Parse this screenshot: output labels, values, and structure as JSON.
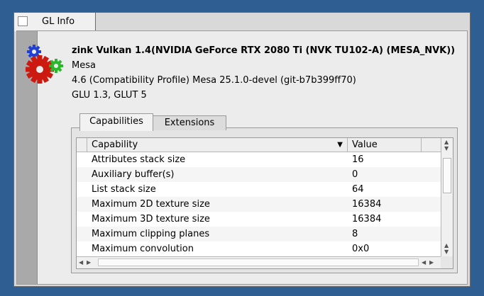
{
  "window": {
    "title": "GL Info",
    "close_icon": "checkbox-close-icon"
  },
  "info": {
    "renderer": "zink Vulkan 1.4(NVIDIA GeForce RTX 2080 Ti (NVK TU102-A) (MESA_NVK))",
    "vendor": "Mesa",
    "version": "4.6 (Compatibility Profile) Mesa 25.1.0-devel (git-b7b399ff70)",
    "glu_glut": "GLU 1.3, GLUT 5",
    "icon": "gears-icon",
    "gear_colors": {
      "blue": "#1f3fd6",
      "red": "#cc1a10",
      "green": "#2cb82c"
    }
  },
  "tabs": [
    {
      "label": "Capabilities",
      "active": true
    },
    {
      "label": "Extensions",
      "active": false
    }
  ],
  "table": {
    "columns": [
      "Capability",
      "Value"
    ],
    "sort_icon": "sort-down-arrow-icon",
    "rows": [
      [
        "Attributes stack size",
        "16"
      ],
      [
        "Auxiliary buffer(s)",
        "0"
      ],
      [
        "List stack size",
        "64"
      ],
      [
        "Maximum 2D texture size",
        "16384"
      ],
      [
        "Maximum 3D texture size",
        "16384"
      ],
      [
        "Maximum clipping planes",
        "8"
      ],
      [
        "Maximum convolution",
        "0x0"
      ]
    ]
  },
  "colors": {
    "desktop": "#2f5f92",
    "selected_tab": "#f2f2f2"
  }
}
